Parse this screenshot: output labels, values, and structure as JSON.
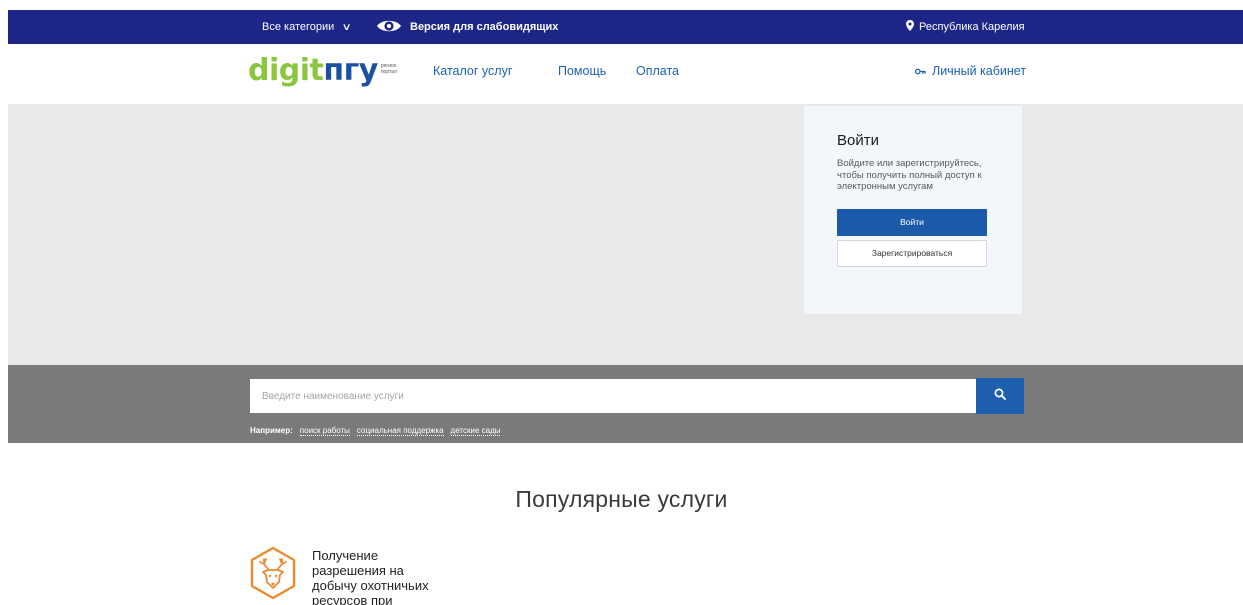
{
  "topbar": {
    "categories_label": "Все категории",
    "accessibility_label": "Версия для слабовидящих",
    "region_label": "Республика Карелия"
  },
  "header": {
    "logo": {
      "part1": "digit",
      "part2": "пгу",
      "small_line1": "регион",
      "small_line2": "портал"
    },
    "nav": [
      "Каталог услуг",
      "Помощь",
      "Оплата"
    ],
    "cabinet_label": "Личный кабинет"
  },
  "login": {
    "title": "Войти",
    "description": "Войдите или зарегистрируйтесь, чтобы получить полный доступ к электронным услугам",
    "login_button": "Войти",
    "register_button": "Зарегистрироваться"
  },
  "search": {
    "placeholder": "Введите наименование услуги",
    "examples_label": "Например:",
    "examples": [
      "поиск работы",
      "социальная поддержка",
      "детские сады"
    ]
  },
  "popular": {
    "title": "Популярные услуги",
    "services": [
      {
        "name": "Получение разрешения на добычу охотничьих ресурсов при",
        "icon": "deer-icon"
      }
    ]
  },
  "colors": {
    "topbar": "#1d2587",
    "primary_button": "#1b5aa8",
    "link": "#1b62b5",
    "logo_green": "#8cc63f",
    "logo_blue": "#1b4f9f",
    "service_icon": "#ee8a2e",
    "hero_bg": "#e9e9ea",
    "search_band": "#7b7a7b"
  }
}
